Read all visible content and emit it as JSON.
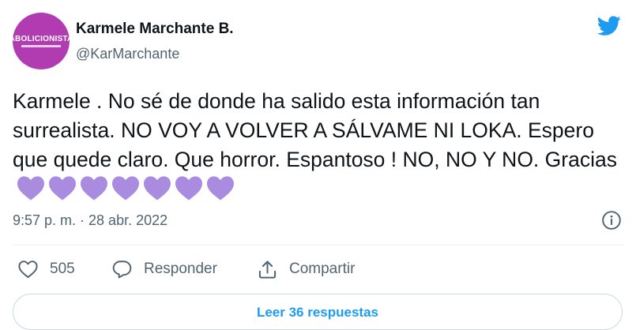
{
  "author": {
    "display_name": "Karmele Marchante B.",
    "handle": "@KarMarchante",
    "avatar_text": "ABOLICIONISTA",
    "avatar_color": "#b13bb0"
  },
  "tweet": {
    "text": "Karmele . No sé de donde ha salido esta información tan surrealista. NO VOY A VOLVER A SÁLVAME NI LOKA. Espero que quede claro. Que horror. Espantoso ! NO, NO Y NO. Gracias",
    "emoji": [
      "purple-heart",
      "purple-heart",
      "purple-heart",
      "purple-heart",
      "purple-heart",
      "purple-heart",
      "purple-heart"
    ],
    "emoji_color": "#a98ce0",
    "timestamp": "9:57 p. m. · 28 abr. 2022"
  },
  "actions": {
    "like_count": "505",
    "reply_label": "Responder",
    "share_label": "Compartir"
  },
  "read_replies_label": "Leer 36 respuestas",
  "colors": {
    "accent": "#1d9bf0",
    "secondary_text": "#536471",
    "border": "#cfd9de"
  },
  "icons": [
    "twitter-bird-icon",
    "info-icon",
    "heart-icon",
    "reply-icon",
    "share-icon"
  ]
}
